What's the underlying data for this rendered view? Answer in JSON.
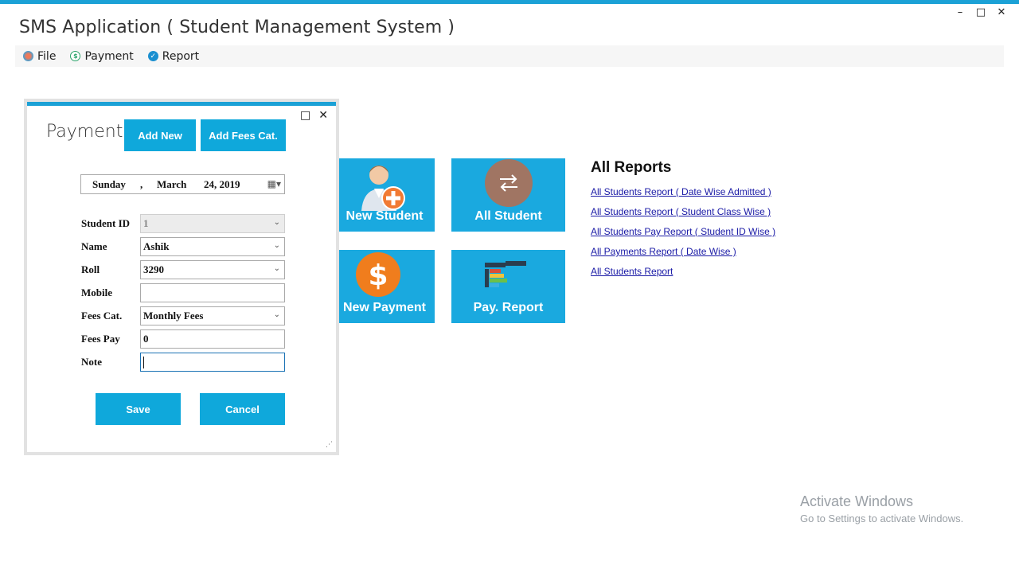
{
  "app": {
    "title": "SMS Application ( Student Management System )",
    "window_controls": [
      "–",
      "□",
      "✕"
    ]
  },
  "menu": [
    {
      "label": "File",
      "icon": "file-icon"
    },
    {
      "label": "Payment",
      "icon": "payment-icon"
    },
    {
      "label": "Report",
      "icon": "report-icon"
    }
  ],
  "tiles": [
    {
      "label": "New Student",
      "icon": "add-student-icon"
    },
    {
      "label": "All Student",
      "icon": "refresh-icon"
    },
    {
      "label": "New Payment",
      "icon": "dollar-icon"
    },
    {
      "label": "Pay. Report",
      "icon": "report-chart-icon"
    }
  ],
  "reports": {
    "title": "All Reports",
    "links": [
      "All Students Report ( Date Wise Admitted )",
      "All Students Report ( Student Class Wise )",
      "All Students Pay Report ( Student ID Wise )",
      "All Payments Report ( Date Wise )",
      "All Students Report"
    ]
  },
  "dialog": {
    "title": "Payment",
    "controls": [
      "□",
      "✕"
    ],
    "add_new_label": "Add New",
    "add_fees_cat_label": "Add Fees Cat.",
    "date": {
      "day": "Sunday",
      "comma": ",",
      "month": "March",
      "date": "24, 2019"
    },
    "fields": {
      "student_id": {
        "label": "Student ID",
        "value": "1"
      },
      "name": {
        "label": "Name",
        "value": "Ashik"
      },
      "roll": {
        "label": "Roll",
        "value": "3290"
      },
      "mobile": {
        "label": "Mobile",
        "value": ""
      },
      "fees_cat": {
        "label": "Fees Cat.",
        "value": "Monthly Fees"
      },
      "fees_pay": {
        "label": "Fees Pay",
        "value": "0"
      },
      "note": {
        "label": "Note",
        "value": ""
      }
    },
    "save_label": "Save",
    "cancel_label": "Cancel"
  },
  "watermark": {
    "line1": "Activate Windows",
    "line2": "Go to Settings to activate Windows."
  }
}
